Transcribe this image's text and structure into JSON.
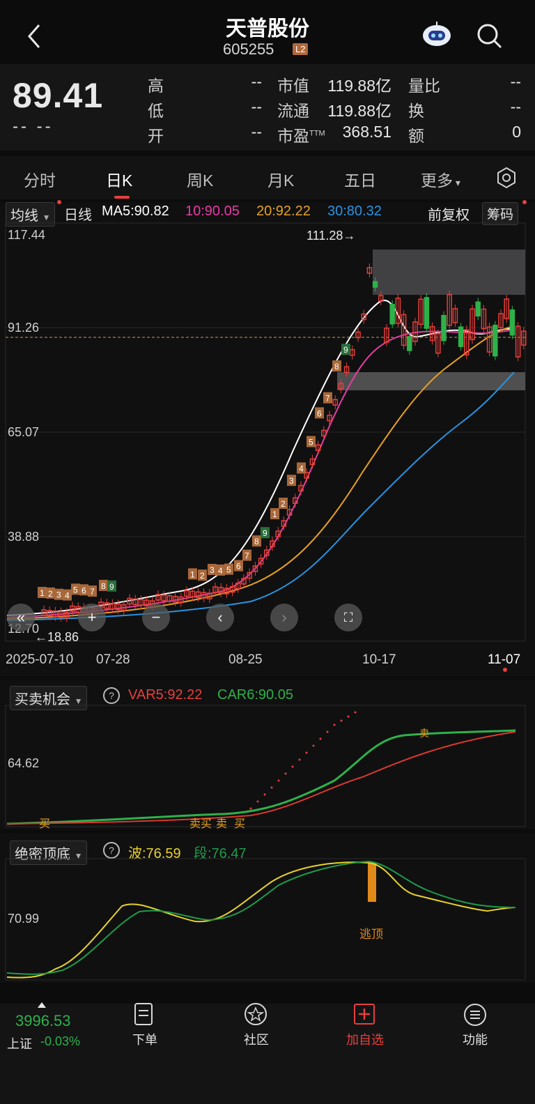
{
  "header": {
    "title": "天普股份",
    "code": "605255",
    "level_badge": "L2"
  },
  "quote": {
    "price": "89.41",
    "change": "-- --",
    "rows": [
      {
        "label1": "高",
        "value1": "--",
        "label2": "市值",
        "value2": "119.88亿",
        "label3": "量比",
        "value3": "--"
      },
      {
        "label1": "低",
        "value1": "--",
        "label2": "流通",
        "value2": "119.88亿",
        "label3": "换",
        "value3": "--"
      },
      {
        "label1": "开",
        "value1": "--",
        "label2": "市盈",
        "label2_sup": "TTM",
        "value2": "368.51",
        "label3": "额",
        "value3": "0"
      }
    ]
  },
  "tabs": [
    "分时",
    "日K",
    "周K",
    "月K",
    "五日",
    "更多"
  ],
  "indicator": {
    "select": "均线",
    "period": "日线",
    "ma5": "MA5:90.82",
    "ma10": "10:90.05",
    "ma20": "20:92.22",
    "ma30": "30:80.32",
    "adjust": "前复权",
    "chip": "筹码"
  },
  "colors": {
    "ma5": "#ffffff",
    "ma10": "#e83ba4",
    "ma20": "#e8a21d",
    "ma30": "#2a93e0",
    "up": "#e8403a",
    "down": "#2fb14a",
    "accent": "#e8403a"
  },
  "main_chart": {
    "y_ticks": [
      "117.44",
      "91.26",
      "65.07",
      "38.88",
      "12.70"
    ],
    "x_ticks": [
      "2025-07-10",
      "07-28",
      "08-25",
      "10-17",
      "11-07"
    ],
    "high_label": "111.28→",
    "low_label": "←18.86"
  },
  "panel1": {
    "select": "买卖机会",
    "var5": "VAR5:92.22",
    "car6": "CAR6:90.05",
    "y_tick": "64.62",
    "labels": [
      "买",
      "卖买",
      "卖",
      "买",
      "卖"
    ]
  },
  "panel2": {
    "select": "绝密顶底",
    "wave": "波:76.59",
    "seg": "段:76.47",
    "y_tick": "70.99",
    "top_label": "逃顶"
  },
  "bottom": {
    "index_value": "3996.53",
    "index_name": "上证",
    "index_change": "-0.03%",
    "items": [
      {
        "label": "下单",
        "icon": "order-icon"
      },
      {
        "label": "社区",
        "icon": "community-icon"
      },
      {
        "label": "加自选",
        "icon": "add-watch-icon"
      },
      {
        "label": "功能",
        "icon": "menu-icon"
      }
    ]
  }
}
